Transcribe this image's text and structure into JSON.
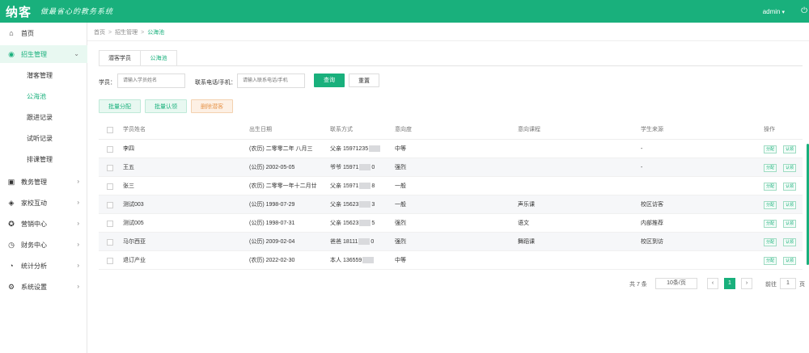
{
  "header": {
    "logo": "纳客",
    "slogan": "做最省心的教务系统",
    "user": "admin",
    "user_caret": "▾",
    "power_icon": "power-icon"
  },
  "sidebar": {
    "items": [
      {
        "label": "首页",
        "icon": "⌂",
        "chevron": ""
      },
      {
        "label": "招生管理",
        "icon": "◉",
        "chevron": "⌄"
      },
      {
        "label": "教务管理",
        "icon": "▣",
        "chevron": "›"
      },
      {
        "label": "家校互动",
        "icon": "◈",
        "chevron": "›"
      },
      {
        "label": "营销中心",
        "icon": "✪",
        "chevron": "›"
      },
      {
        "label": "财务中心",
        "icon": "◷",
        "chevron": "›"
      },
      {
        "label": "统计分析",
        "icon": "◔",
        "chevron": "›"
      },
      {
        "label": "系统设置",
        "icon": "⚙",
        "chevron": "›"
      }
    ],
    "sub_items": [
      {
        "label": "潜客管理"
      },
      {
        "label": "公海池"
      },
      {
        "label": "跟进记录"
      },
      {
        "label": "试听记录"
      },
      {
        "label": "排课管理"
      }
    ]
  },
  "breadcrumb": {
    "items": [
      "首页",
      "招生管理",
      "公海池"
    ]
  },
  "tabs": [
    {
      "label": "潜客学员"
    },
    {
      "label": "公海池"
    }
  ],
  "filters": {
    "name_label": "学员：",
    "name_placeholder": "请输入学员姓名",
    "phone_label": "联系电话/手机：",
    "phone_placeholder": "请输入联系电话/手机",
    "search_button": "查询",
    "reset_button": "重置"
  },
  "actions": {
    "batch_assign": "批量分配",
    "batch_claim": "批量认领",
    "delete": "删除潜客"
  },
  "table": {
    "headers": [
      "学员姓名",
      "出生日期",
      "联系方式",
      "意向度",
      "意向课程",
      "学生来源",
      "操作"
    ],
    "rows": [
      {
        "name": "李四",
        "birth": "(农历) 二零零二年 八月三",
        "contact_prefix": "父亲 15971235",
        "contact_suffix": "",
        "intent": "中等",
        "course": "",
        "source": "-"
      },
      {
        "name": "王五",
        "birth": "(公历) 2002-05-05",
        "contact_prefix": "爷爷 15971",
        "contact_suffix": "0",
        "intent": "强烈",
        "course": "",
        "source": "-"
      },
      {
        "name": "张三",
        "birth": "(农历) 二零零一年十二月廿",
        "contact_prefix": "父亲 15971",
        "contact_suffix": "8",
        "intent": "一般",
        "course": "",
        "source": ""
      },
      {
        "name": "测试003",
        "birth": "(公历) 1998-07-29",
        "contact_prefix": "父亲 15623",
        "contact_suffix": "3",
        "intent": "一般",
        "course": "声乐课",
        "source": "校区访客"
      },
      {
        "name": "测试005",
        "birth": "(公历) 1998-07-31",
        "contact_prefix": "父亲 15623",
        "contact_suffix": "5",
        "intent": "强烈",
        "course": "语文",
        "source": "内部推荐"
      },
      {
        "name": "马尔西亚",
        "birth": "(公历) 2009-02-04",
        "contact_prefix": "爸爸 18111",
        "contact_suffix": "0",
        "intent": "强烈",
        "course": "舞蹈课",
        "source": "校区到访"
      },
      {
        "name": "退订产业",
        "birth": "(农历) 2022-02-30",
        "contact_prefix": "本人 136559",
        "contact_suffix": "",
        "intent": "中等",
        "course": "",
        "source": ""
      }
    ],
    "op_assign": "分配",
    "op_claim": "认领"
  },
  "pagination": {
    "total": "共 7 条",
    "page_size": "10条/页",
    "prev": "‹",
    "current": "1",
    "next": "›",
    "goto_label": "前往",
    "goto_value": "1",
    "page_suffix": "页"
  },
  "colors": {
    "brand": "#19b07c"
  }
}
